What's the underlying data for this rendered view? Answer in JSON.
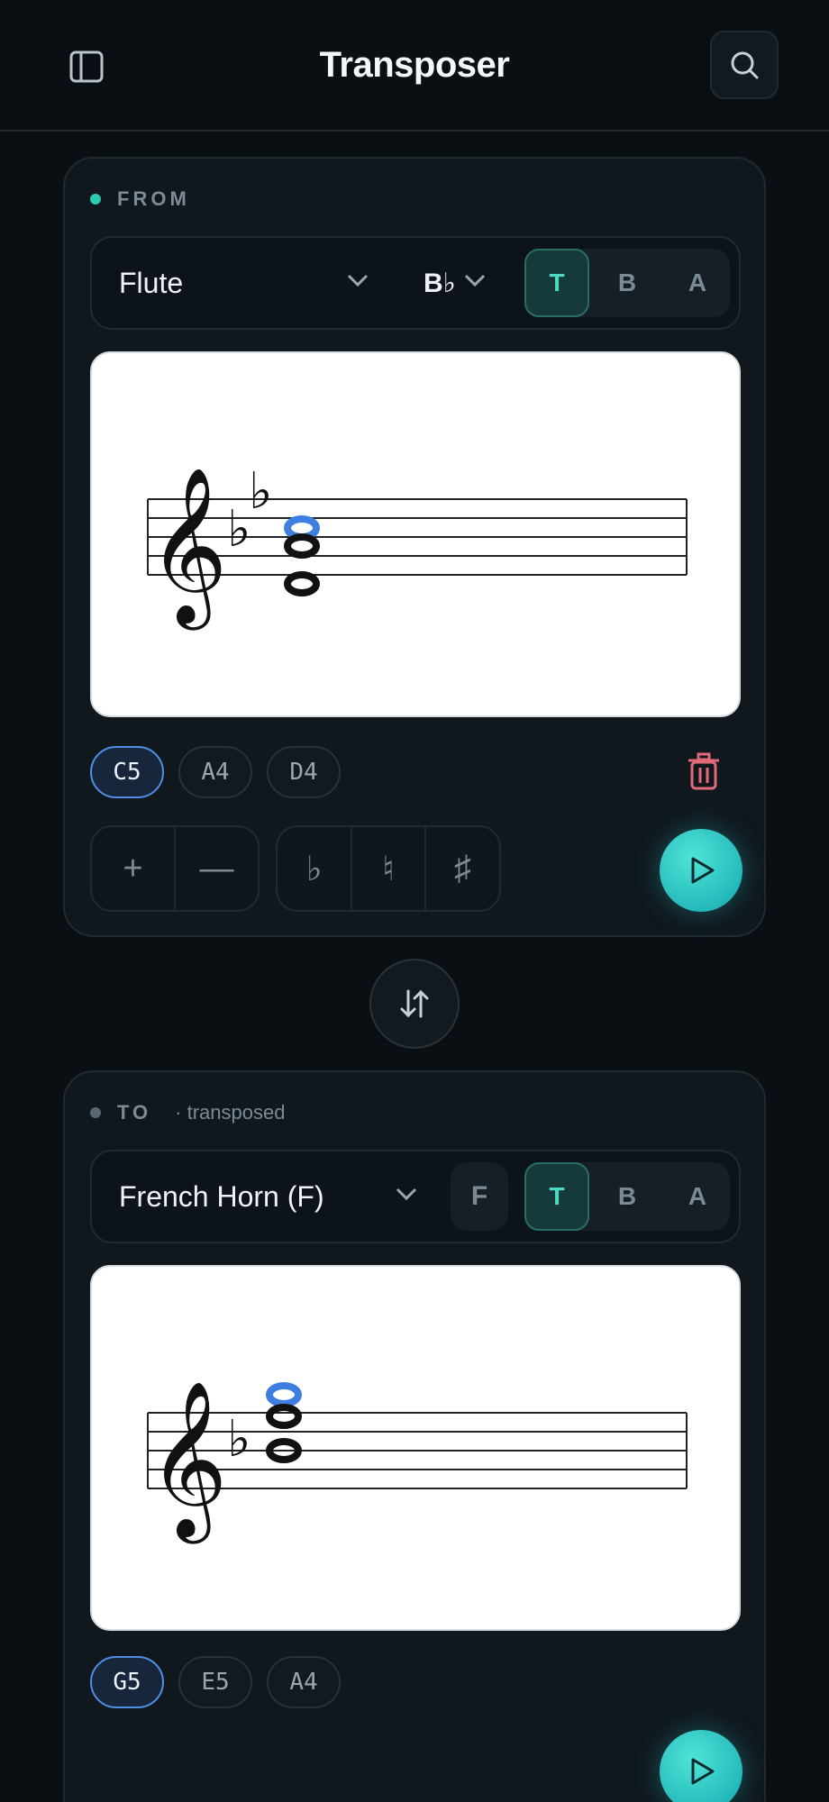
{
  "header": {
    "title": "Transposer"
  },
  "from": {
    "label": "FROM",
    "instrument": "Flute",
    "key_signature": "B♭",
    "clefs": [
      "T",
      "B",
      "A"
    ],
    "active_clef": "T",
    "notes": [
      "C5",
      "A4",
      "D4"
    ],
    "active_note": "C5",
    "controls": {
      "add": "+",
      "remove": "—",
      "flat": "♭",
      "natural": "♮",
      "sharp": "♯"
    }
  },
  "to": {
    "label": "TO",
    "sub_label": "· transposed",
    "instrument": "French Horn (F)",
    "key_badge": "F",
    "clefs": [
      "T",
      "B",
      "A"
    ],
    "active_clef": "T",
    "notes": [
      "G5",
      "E5",
      "A4"
    ],
    "active_note": "G5"
  },
  "colors": {
    "accent": "#2bcab1",
    "highlight_note": "#3d7fe0",
    "delete": "#e26a78"
  },
  "icons": {
    "sidebar": "sidebar-icon",
    "search": "search-icon",
    "swap": "swap-vertical-icon",
    "play": "play-icon",
    "delete": "trash-icon"
  }
}
